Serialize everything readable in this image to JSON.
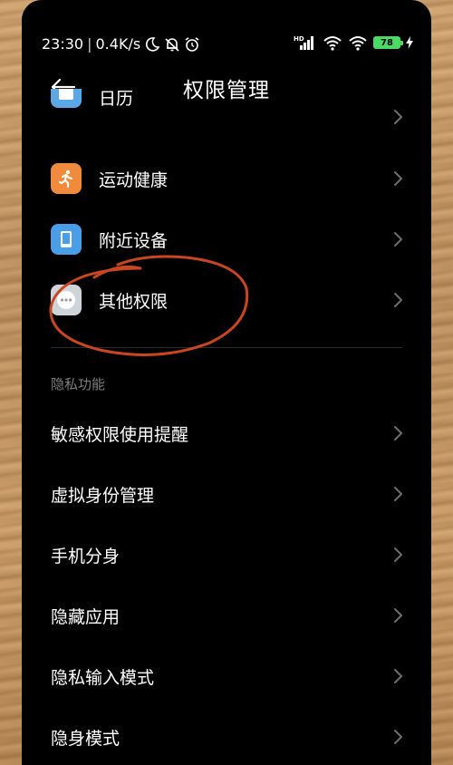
{
  "status": {
    "time": "23:30",
    "speed": "0.4K/s",
    "battery": "78",
    "network": "HD"
  },
  "header": {
    "title": "权限管理"
  },
  "app_items": [
    {
      "label": "日历",
      "icon": "calendar-icon",
      "color": "#5aa8e6"
    },
    {
      "label": "运动健康",
      "icon": "running-icon",
      "color": "#f08a3c"
    },
    {
      "label": "附近设备",
      "icon": "tablet-icon",
      "color": "#4a9ee8"
    },
    {
      "label": "其他权限",
      "icon": "more-dots-icon",
      "color": "#cfd3da"
    }
  ],
  "privacy": {
    "section_label": "隐私功能",
    "items": [
      {
        "label": "敏感权限使用提醒"
      },
      {
        "label": "虚拟身份管理"
      },
      {
        "label": "手机分身"
      },
      {
        "label": "隐藏应用"
      },
      {
        "label": "隐私输入模式"
      },
      {
        "label": "隐身模式"
      }
    ]
  },
  "colors": {
    "annotation_circle": "#c9461e",
    "background": "#000000",
    "text": "#ffffff",
    "muted": "#7d7d7d"
  }
}
